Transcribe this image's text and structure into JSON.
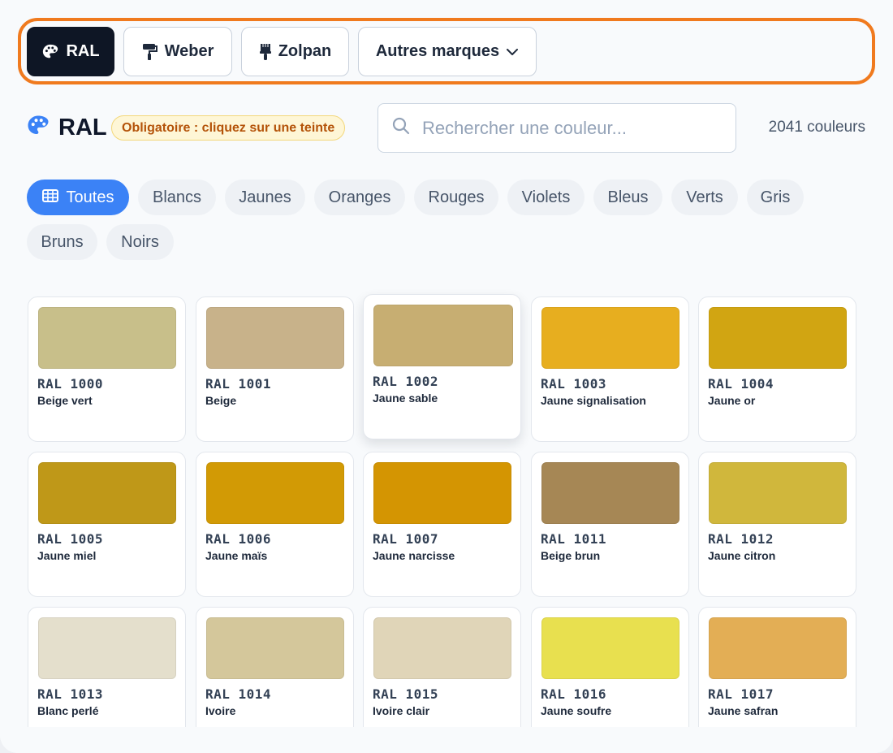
{
  "brands": [
    {
      "label": "RAL",
      "icon": "palette-icon",
      "active": true
    },
    {
      "label": "Weber",
      "icon": "paint-roller-icon",
      "active": false
    },
    {
      "label": "Zolpan",
      "icon": "paint-brush-icon",
      "active": false
    },
    {
      "label": "Autres marques",
      "icon": "chevron-down-icon",
      "active": false
    }
  ],
  "header": {
    "title": "RAL",
    "title_icon": "palette-icon",
    "badge": "Obligatoire : cliquez sur une teinte",
    "count": "2041 couleurs"
  },
  "search": {
    "placeholder": "Rechercher une couleur...",
    "value": ""
  },
  "filters": [
    "Toutes",
    "Blancs",
    "Jaunes",
    "Oranges",
    "Rouges",
    "Violets",
    "Bleus",
    "Verts",
    "Gris",
    "Bruns",
    "Noirs"
  ],
  "active_filter": "Toutes",
  "colors": [
    {
      "code": "RAL 1000",
      "name": "Beige vert",
      "hex": "#c8bf8a"
    },
    {
      "code": "RAL 1001",
      "name": "Beige",
      "hex": "#c8b28a"
    },
    {
      "code": "RAL 1002",
      "name": "Jaune sable",
      "hex": "#c7ae72"
    },
    {
      "code": "RAL 1003",
      "name": "Jaune signalisation",
      "hex": "#e7ae1f"
    },
    {
      "code": "RAL 1004",
      "name": "Jaune or",
      "hex": "#d1a512"
    },
    {
      "code": "RAL 1005",
      "name": "Jaune miel",
      "hex": "#bf9818"
    },
    {
      "code": "RAL 1006",
      "name": "Jaune maïs",
      "hex": "#d29a05"
    },
    {
      "code": "RAL 1007",
      "name": "Jaune narcisse",
      "hex": "#d49502"
    },
    {
      "code": "RAL 1011",
      "name": "Beige brun",
      "hex": "#a68755"
    },
    {
      "code": "RAL 1012",
      "name": "Jaune citron",
      "hex": "#d0b73c"
    },
    {
      "code": "RAL 1013",
      "name": "Blanc perlé",
      "hex": "#e4dfcc"
    },
    {
      "code": "RAL 1014",
      "name": "Ivoire",
      "hex": "#d4c79b"
    },
    {
      "code": "RAL 1015",
      "name": "Ivoire clair",
      "hex": "#e0d5b8"
    },
    {
      "code": "RAL 1016",
      "name": "Jaune soufre",
      "hex": "#e8e04f"
    },
    {
      "code": "RAL 1017",
      "name": "Jaune safran",
      "hex": "#e3ae55"
    }
  ],
  "accent": "#3b82f6",
  "highlight_border": "#f07a1e"
}
